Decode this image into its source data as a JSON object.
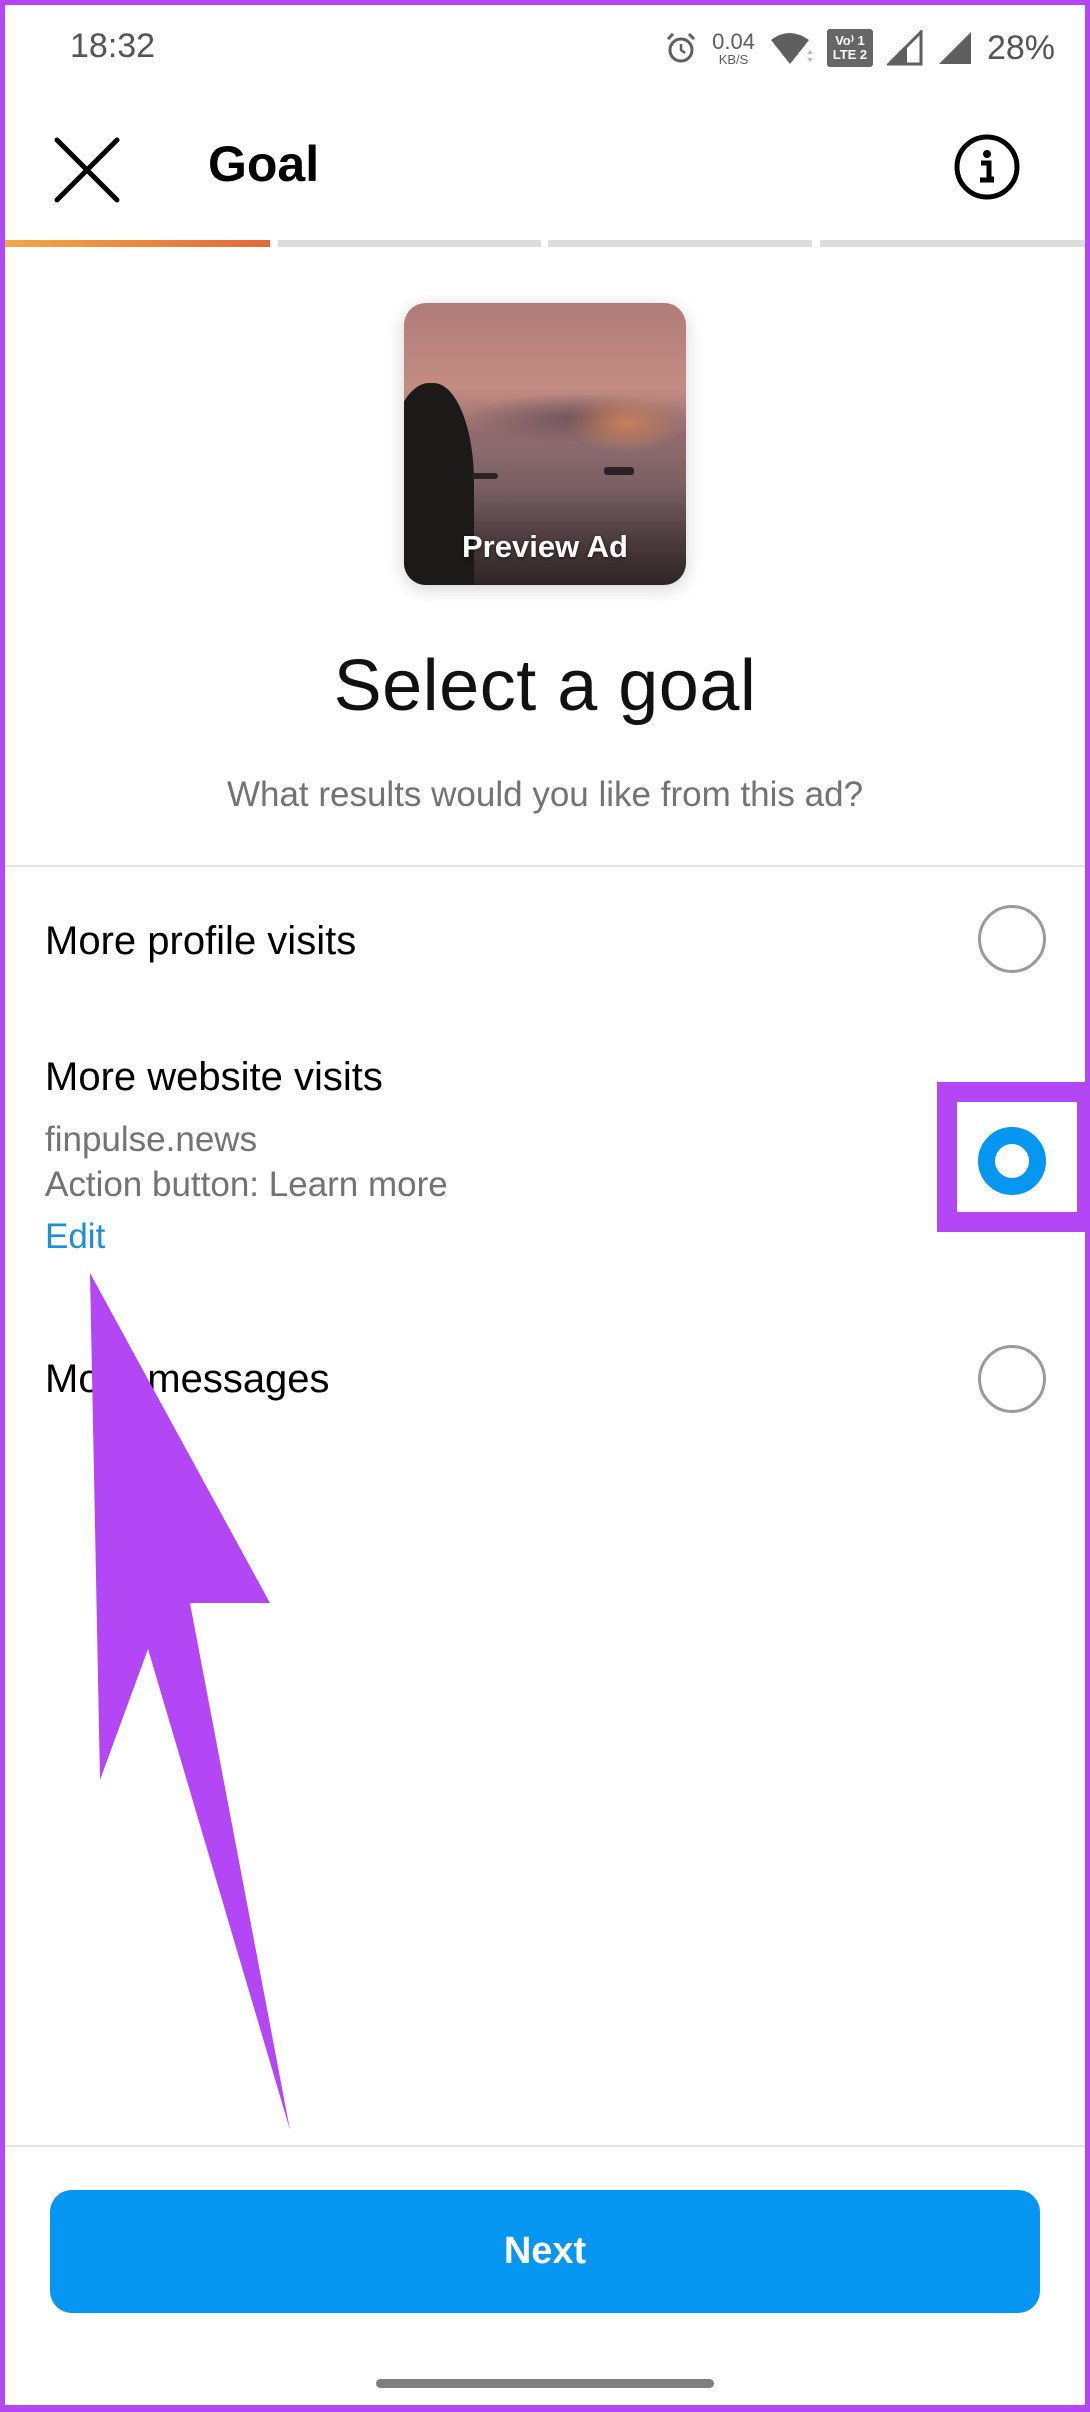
{
  "status_bar": {
    "time": "18:32",
    "net_speed_value": "0.04",
    "net_speed_unit": "KB/S",
    "volte_line1": "Vo⁾ 1",
    "volte_line2": "LTE 2",
    "battery": "28%",
    "icons": [
      "alarm-icon",
      "wifi-icon",
      "volte-icon",
      "signal-sim1-icon",
      "signal-sim2-icon"
    ]
  },
  "header": {
    "title": "Goal",
    "close_icon": "close-icon",
    "info_icon": "info-icon"
  },
  "progress": {
    "total_steps": 4,
    "current_step": 1
  },
  "preview": {
    "label": "Preview Ad"
  },
  "main": {
    "heading": "Select a goal",
    "subheading": "What results would you like from this ad?"
  },
  "options": [
    {
      "title": "More profile visits",
      "selected": false
    },
    {
      "title": "More website visits",
      "website": "finpulse.news",
      "action_button": "Action button: Learn more",
      "edit_label": "Edit",
      "selected": true
    },
    {
      "title": "More messages",
      "selected": false
    }
  ],
  "footer": {
    "next_label": "Next"
  },
  "annotation": {
    "color": "#b347f5"
  },
  "colors": {
    "accent": "#0596f2",
    "link": "#1e8fd6",
    "progress_active_start": "#f0a848",
    "progress_active_end": "#e06a3a"
  }
}
